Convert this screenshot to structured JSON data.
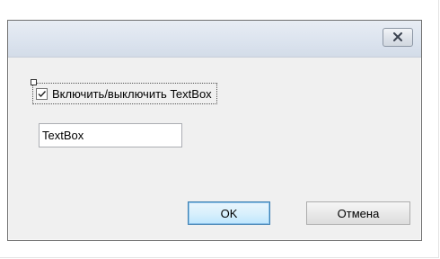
{
  "dialog": {
    "close_icon": "close-icon",
    "checkbox": {
      "label": "Включить/выключить TextBox",
      "checked": true
    },
    "textbox": {
      "value": "TextBox"
    },
    "buttons": {
      "ok_label": "OK",
      "cancel_label": "Отмена"
    }
  },
  "colors": {
    "titlebar": "#dbe3ee",
    "client": "#f0f0f0",
    "default_button_border": "#3c7fb1"
  }
}
